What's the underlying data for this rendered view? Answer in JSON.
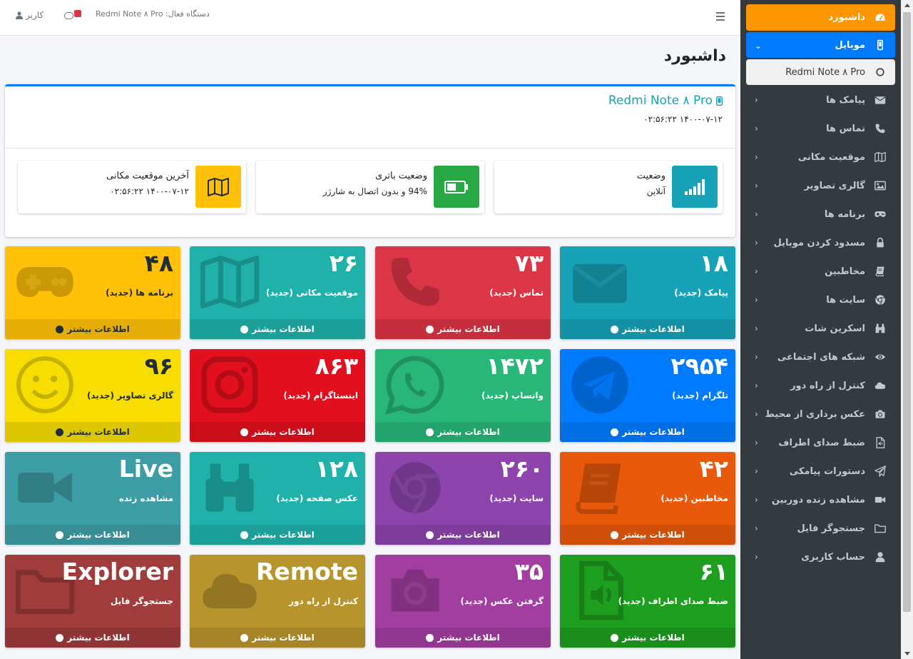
{
  "topbar": {
    "device_label": "دستگاه فعال: Redmi Note ۸ Pro",
    "user_label": "کاربر"
  },
  "sidebar": {
    "items": [
      {
        "label": "داشبورد",
        "icon": "dashboard-icon"
      },
      {
        "label": "موبایل",
        "icon": "mobile-icon"
      },
      {
        "label": "Redmi Note ۸ Pro",
        "icon": "circle-icon"
      },
      {
        "label": "پیامک ها",
        "icon": "envelope-icon"
      },
      {
        "label": "تماس ها",
        "icon": "phone-icon"
      },
      {
        "label": "موقعیت مکانی",
        "icon": "map-icon"
      },
      {
        "label": "گالری تصاویر",
        "icon": "image-icon"
      },
      {
        "label": "برنامه ها",
        "icon": "gamepad-icon"
      },
      {
        "label": "مسدود کردن موبایل",
        "icon": "lock-icon"
      },
      {
        "label": "مخاطبین",
        "icon": "book-icon"
      },
      {
        "label": "سایت ها",
        "icon": "chrome-icon"
      },
      {
        "label": "اسکرین شات",
        "icon": "binoculars-icon"
      },
      {
        "label": "شبکه های اجتماعی",
        "icon": "eye-icon"
      },
      {
        "label": "کنترل از راه دور",
        "icon": "cloud-icon"
      },
      {
        "label": "عکس برداری از محیط",
        "icon": "camera-icon"
      },
      {
        "label": "ضبط صدای اطراف",
        "icon": "audio-file-icon"
      },
      {
        "label": "دستورات پیامکی",
        "icon": "paper-plane-icon"
      },
      {
        "label": "مشاهده زنده دوربین",
        "icon": "video-icon"
      },
      {
        "label": "جستجوگر فایل",
        "icon": "folder-icon"
      },
      {
        "label": "حساب کاربری",
        "icon": "user-icon"
      }
    ]
  },
  "page": {
    "title": "داشبورد"
  },
  "device_card": {
    "name": "Redmi Note ۸ Pro",
    "time": "۱۴۰۰-۰۷-۱۲ ۰۲:۵۶:۲۲",
    "status": {
      "title": "وضعیت",
      "value": "آنلاین",
      "color": "#17a2b8"
    },
    "battery": {
      "title": "وضعیت باتری",
      "value": "94% و بدون اتصال به شارژر",
      "color": "#28a745"
    },
    "location": {
      "title": "آخرین موقعیت مکانی",
      "value": "۱۴۰۰-۰۷-۱۲ ۰۲:۵۶:۲۲",
      "color": "#ffc107"
    }
  },
  "more_info_label": "اطلاعات بیشتر",
  "boxes": [
    {
      "num": "۱۸",
      "sub": "پیامک (جدید)",
      "color": "#17a2b8",
      "icon": "envelope-icon"
    },
    {
      "num": "۷۳",
      "sub": "تماس (جدید)",
      "color": "#dc3545",
      "icon": "phone-icon"
    },
    {
      "num": "۲۶",
      "sub": "موقعیت مکانی (جدید)",
      "color": "#20b2aa",
      "icon": "map-icon"
    },
    {
      "num": "۴۸",
      "sub": "برنامه ها (جدید)",
      "color": "#ffc107",
      "icon": "gamepad-icon"
    },
    {
      "num": "۲۹۵۴",
      "sub": "تلگرام (جدید)",
      "color": "#007bff",
      "icon": "telegram-icon"
    },
    {
      "num": "۱۴۷۲",
      "sub": "واتساپ (جدید)",
      "color": "#28b779",
      "icon": "whatsapp-icon"
    },
    {
      "num": "۸۶۳",
      "sub": "اینستاگرام (جدید)",
      "color": "#e2101e",
      "icon": "instagram-icon"
    },
    {
      "num": "۹۶",
      "sub": "گالری تصاویر (جدید)",
      "color": "#f7de00",
      "icon": "smile-icon"
    },
    {
      "num": "۴۲",
      "sub": "مخاطبین (جدید)",
      "color": "#e8590c",
      "icon": "book-icon"
    },
    {
      "num": "۲۶۰",
      "sub": "سایت (جدید)",
      "color": "#8e44ad",
      "icon": "chrome-icon"
    },
    {
      "num": "۱۲۸",
      "sub": "عکس صفحه (جدید)",
      "color": "#20b2aa",
      "icon": "binoculars-icon"
    },
    {
      "num": "Live",
      "sub": "مشاهده زنده",
      "color": "#3d9da5",
      "icon": "video-icon"
    },
    {
      "num": "۶۱",
      "sub": "ضبط صدای اطراف (جدید)",
      "color": "#1e9e1e",
      "icon": "audio-file-icon"
    },
    {
      "num": "۳۵",
      "sub": "گرفتن عکس (جدید)",
      "color": "#a23ea0",
      "icon": "camera-icon"
    },
    {
      "num": "Remote",
      "sub": "کنترل از راه دور",
      "color": "#b8952c",
      "icon": "cloud-icon"
    },
    {
      "num": "Explorer",
      "sub": "جستجوگر فایل",
      "color": "#a13c3c",
      "icon": "folder-icon"
    }
  ]
}
